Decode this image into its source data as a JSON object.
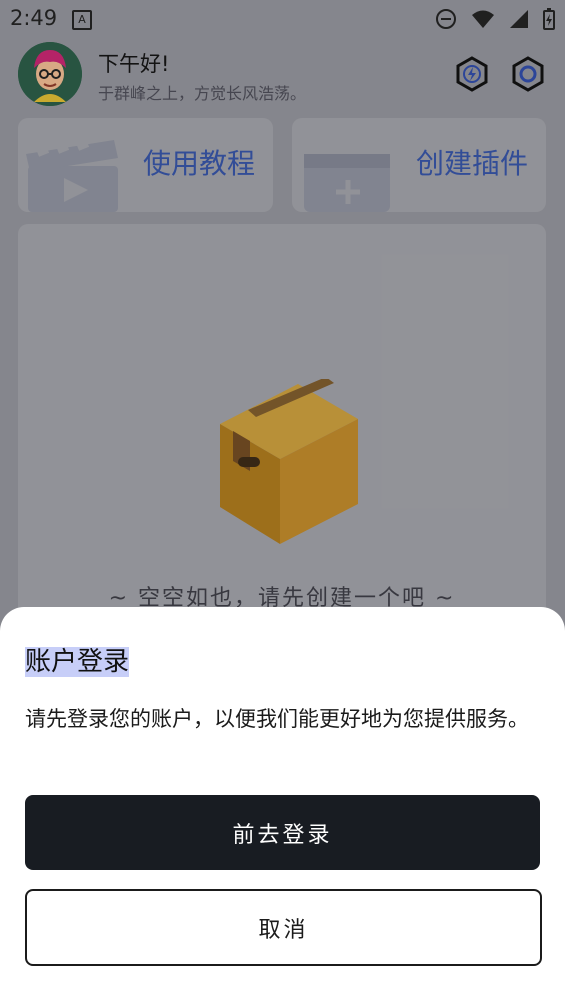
{
  "status_bar": {
    "time": "2:49",
    "a_badge": "A",
    "icons": [
      "do-not-disturb-icon",
      "wifi-icon",
      "signal-icon",
      "battery-icon"
    ]
  },
  "header": {
    "greeting": "下午好!",
    "subtitle": "于群峰之上，方觉长风浩荡。",
    "icons": [
      "lightning-hex-icon",
      "settings-hex-icon"
    ]
  },
  "cards": [
    {
      "title": "使用教程",
      "icon": "clapperboard-icon"
    },
    {
      "title": "创建插件",
      "icon": "add-window-icon"
    }
  ],
  "empty_state": {
    "text": "~ 空空如也，请先创建一个吧 ~",
    "icon": "box-icon"
  },
  "sheet": {
    "title": "账户登录",
    "description": "请先登录您的账户，以便我们能更好地为您提供服务。",
    "primary_button": "前去登录",
    "secondary_button": "取消"
  },
  "colors": {
    "accent_text": "#3652a1",
    "primary_button_bg": "#181c22",
    "title_highlight": "#c7cef8"
  }
}
